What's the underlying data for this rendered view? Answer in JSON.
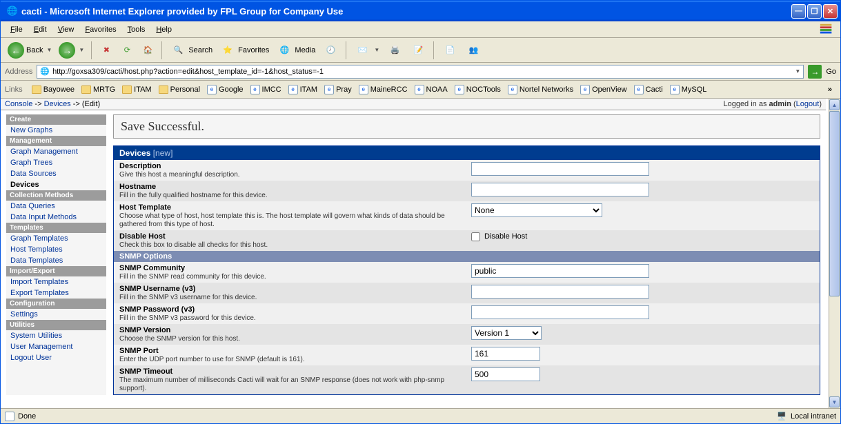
{
  "titlebar": {
    "title": "cacti - Microsoft Internet Explorer provided by FPL Group for Company Use"
  },
  "menubar": {
    "items": [
      "File",
      "Edit",
      "View",
      "Favorites",
      "Tools",
      "Help"
    ]
  },
  "toolbar": {
    "back": "Back",
    "search": "Search",
    "favorites": "Favorites",
    "media": "Media"
  },
  "addressbar": {
    "label": "Address",
    "url": "http://goxsa309/cacti/host.php?action=edit&host_template_id=-1&host_status=-1",
    "go": "Go"
  },
  "linksbar": {
    "label": "Links",
    "items": [
      "Bayowee",
      "MRTG",
      "ITAM",
      "Personal",
      "Google",
      "IMCC",
      "ITAM",
      "Pray",
      "MaineRCC",
      "NOAA",
      "NOCTools",
      "Nortel Networks",
      "OpenView",
      "Cacti",
      "MySQL"
    ]
  },
  "cacti": {
    "breadcrumb": {
      "console": "Console",
      "devices": "Devices",
      "edit": "(Edit)"
    },
    "login": {
      "text": "Logged in as ",
      "user": "admin",
      "logout": "Logout"
    },
    "sidebar": {
      "s1": {
        "header": "Create",
        "items": [
          "New Graphs"
        ]
      },
      "s2": {
        "header": "Management",
        "items": [
          "Graph Management",
          "Graph Trees",
          "Data Sources",
          "Devices"
        ]
      },
      "s3": {
        "header": "Collection Methods",
        "items": [
          "Data Queries",
          "Data Input Methods"
        ]
      },
      "s4": {
        "header": "Templates",
        "items": [
          "Graph Templates",
          "Host Templates",
          "Data Templates"
        ]
      },
      "s5": {
        "header": "Import/Export",
        "items": [
          "Import Templates",
          "Export Templates"
        ]
      },
      "s6": {
        "header": "Configuration",
        "items": [
          "Settings"
        ]
      },
      "s7": {
        "header": "Utilities",
        "items": [
          "System Utilities",
          "User Management",
          "Logout User"
        ]
      }
    },
    "save_msg": "Save Successful.",
    "table": {
      "header": "Devices",
      "header_new": "[new]",
      "rows": {
        "desc": {
          "label": "Description",
          "hint": "Give this host a meaningful description.",
          "value": ""
        },
        "hostname": {
          "label": "Hostname",
          "hint": "Fill in the fully qualified hostname for this device.",
          "value": ""
        },
        "template": {
          "label": "Host Template",
          "hint": "Choose what type of host, host template this is. The host template will govern what kinds of data should be gathered from this type of host.",
          "value": "None"
        },
        "disable": {
          "label": "Disable Host",
          "hint": "Check this box to disable all checks for this host.",
          "cb_label": "Disable Host"
        },
        "snmp_header": "SNMP Options",
        "community": {
          "label": "SNMP Community",
          "hint": "Fill in the SNMP read community for this device.",
          "value": "public"
        },
        "username": {
          "label": "SNMP Username (v3)",
          "hint": "Fill in the SNMP v3 username for this device.",
          "value": ""
        },
        "password": {
          "label": "SNMP Password (v3)",
          "hint": "Fill in the SNMP v3 password for this device.",
          "value": ""
        },
        "version": {
          "label": "SNMP Version",
          "hint": "Choose the SNMP version for this host.",
          "value": "Version 1"
        },
        "port": {
          "label": "SNMP Port",
          "hint": "Enter the UDP port number to use for SNMP (default is 161).",
          "value": "161"
        },
        "timeout": {
          "label": "SNMP Timeout",
          "hint": "The maximum number of milliseconds Cacti will wait for an SNMP response (does not work with php-snmp support).",
          "value": "500"
        }
      }
    }
  },
  "statusbar": {
    "done": "Done",
    "zone": "Local intranet"
  }
}
